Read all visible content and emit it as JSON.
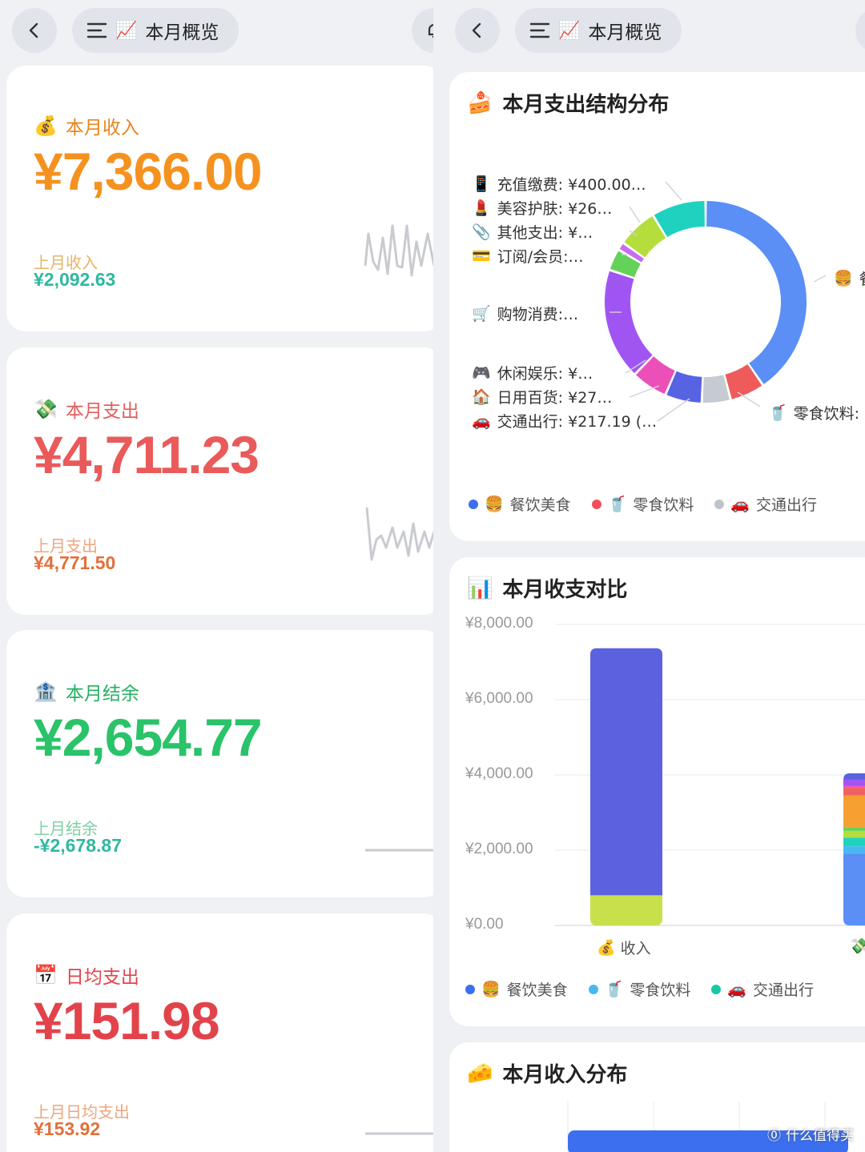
{
  "nav": {
    "title_left": "本月概览",
    "title_right": "本月概览"
  },
  "stats": [
    {
      "label": "本月收入",
      "amount": "¥7,366.00",
      "prev_label": "上月收入",
      "prev_value": "¥2,092.63",
      "amount_color": "#f5921f",
      "label_color": "#e8851c",
      "prev_label_color": "#e6b567",
      "prev_value_color": "#2fb8a0"
    },
    {
      "label": "本月支出",
      "amount": "¥4,711.23",
      "prev_label": "上月支出",
      "prev_value": "¥4,771.50",
      "amount_color": "#ea5a5a",
      "label_color": "#e35d5d",
      "prev_label_color": "#eda680",
      "prev_value_color": "#e2703a"
    },
    {
      "label": "本月结余",
      "amount": "¥2,654.77",
      "prev_label": "上月结余",
      "prev_value": "-¥2,678.87",
      "amount_color": "#2ac36a",
      "label_color": "#25b061",
      "prev_label_color": "#7fd0a4",
      "prev_value_color": "#2fb8a0"
    },
    {
      "label": "日均支出",
      "amount": "¥151.98",
      "prev_label": "上月日均支出",
      "prev_value": "¥153.92",
      "amount_color": "#e2434b",
      "label_color": "#e2434b",
      "prev_label_color": "#eda680",
      "prev_value_color": "#e2703a"
    }
  ],
  "pie_card": {
    "title": "本月支出结构分布",
    "left_labels": [
      {
        "icon": "📱",
        "text": "充值缴费: ¥400.00…"
      },
      {
        "icon": "💄",
        "text": "美容护肤: ¥26…"
      },
      {
        "icon": "📎",
        "text": "其他支出: ¥…"
      },
      {
        "icon": "💳",
        "text": "订阅/会员:…"
      },
      {
        "icon": "🛒",
        "text": "购物消费:…"
      },
      {
        "icon": "🎮",
        "text": "休闲娱乐: ¥…"
      },
      {
        "icon": "🏠",
        "text": "日用百货: ¥27…"
      },
      {
        "icon": "🚗",
        "text": "交通出行: ¥217.19 (…"
      }
    ],
    "right_labels": [
      {
        "icon": "🍔",
        "text": "餐"
      },
      {
        "icon": "🥤",
        "text": "零食饮料:"
      }
    ],
    "legend": [
      {
        "icon": "🍔",
        "text": "餐饮美食",
        "color": "#3b6ff0"
      },
      {
        "icon": "🥤",
        "text": "零食饮料",
        "color": "#f0505a"
      },
      {
        "icon": "🚗",
        "text": "交通出行",
        "color": "#bfc3cb"
      }
    ]
  },
  "bar_card": {
    "title": "本月收支对比",
    "legend": [
      {
        "icon": "🍔",
        "text": "餐饮美食",
        "color": "#3b6ff0"
      },
      {
        "icon": "🥤",
        "text": "零食饮料",
        "color": "#4ab8f0"
      },
      {
        "icon": "🚗",
        "text": "交通出行",
        "color": "#19c7a6"
      }
    ]
  },
  "income_card": {
    "title": "本月收入分布"
  },
  "watermark": "什么值得买",
  "chart_data": [
    {
      "type": "pie",
      "title": "本月支出结构分布",
      "slices": [
        {
          "name": "餐饮美食",
          "value": 0.404,
          "color": "#5b8ff5"
        },
        {
          "name": "零食饮料",
          "value": 0.056,
          "color": "#ef5b5b"
        },
        {
          "name": "交通出行",
          "value": 0.046,
          "color": "#c6cad1"
        },
        {
          "name": "日用百货",
          "value": 0.059,
          "color": "#5863e3"
        },
        {
          "name": "休闲娱乐",
          "value": 0.058,
          "color": "#ec4fb8"
        },
        {
          "name": "购物消费",
          "value": 0.178,
          "color": "#a055f2"
        },
        {
          "name": "订阅/会员",
          "value": 0.035,
          "color": "#64d25a"
        },
        {
          "name": "其他支出",
          "value": 0.013,
          "color": "#c86cf0"
        },
        {
          "name": "美容护肤",
          "value": 0.064,
          "color": "#b5de3d"
        },
        {
          "name": "充值缴费",
          "value": 0.087,
          "color": "#1fd2c0"
        }
      ]
    },
    {
      "type": "bar",
      "title": "本月收支对比",
      "categories": [
        "收入",
        "支出"
      ],
      "y_ticks": [
        "¥8,000.00",
        "¥6,000.00",
        "¥4,000.00",
        "¥2,000.00",
        "¥0.00"
      ],
      "ylim": [
        0,
        8000
      ],
      "stacks": [
        {
          "category": "收入",
          "segments": [
            {
              "value": 800,
              "color": "#c8e04c"
            },
            {
              "value": 6566,
              "color": "#5b62e0"
            }
          ]
        },
        {
          "category": "支出",
          "segments": [
            {
              "value": 1903,
              "color": "#5b8ff5"
            },
            {
              "value": 200,
              "color": "#4ab8f0"
            },
            {
              "value": 230,
              "color": "#1fd2c0"
            },
            {
              "value": 180,
              "color": "#b5de3d"
            },
            {
              "value": 100,
              "color": "#64d25a"
            },
            {
              "value": 840,
              "color": "#f5a030"
            },
            {
              "value": 210,
              "color": "#f06262"
            },
            {
              "value": 60,
              "color": "#ec4fb8"
            },
            {
              "value": 160,
              "color": "#a055f2"
            },
            {
              "value": 160,
              "color": "#5b62e0"
            }
          ]
        }
      ]
    }
  ]
}
